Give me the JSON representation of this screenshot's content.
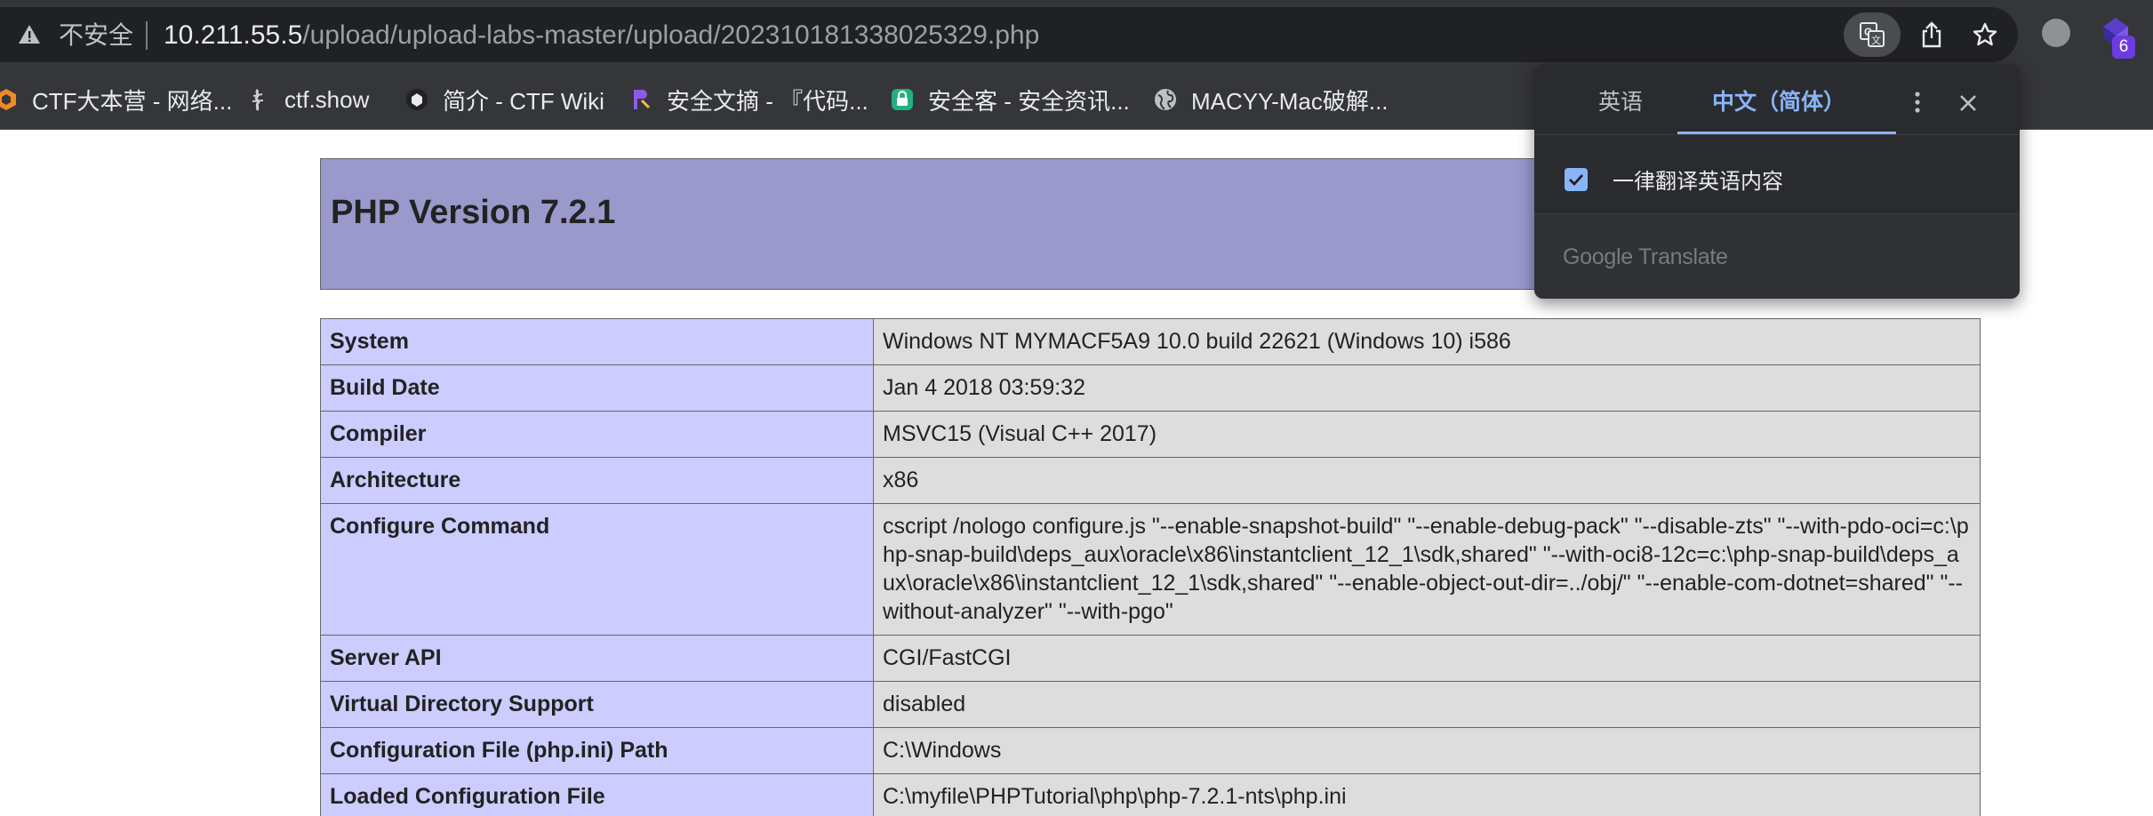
{
  "browser": {
    "insecure_label": "不安全",
    "url_host": "10.211.55.5",
    "url_path": "/upload/upload-labs-master/upload/202310181338025329.php",
    "extension_badge": "6"
  },
  "bookmarks": [
    {
      "label": "CTF大本营 - 网络...",
      "icon": "ctf-camp-icon"
    },
    {
      "label": "ctf.show",
      "icon": "ctfshow-icon"
    },
    {
      "label": "简介 - CTF Wiki",
      "icon": "ctf-wiki-icon"
    },
    {
      "label": "安全文摘 - 『代码...",
      "icon": "security-digest-icon"
    },
    {
      "label": "安全客 - 安全资讯...",
      "icon": "anquanke-icon"
    },
    {
      "label": "MACYY-Mac破解...",
      "icon": "globe-icon"
    }
  ],
  "php": {
    "title": "PHP Version 7.2.1",
    "rows": [
      {
        "label": "System",
        "value": "Windows NT MYMACF5A9 10.0 build 22621 (Windows 10) i586"
      },
      {
        "label": "Build Date",
        "value": "Jan 4 2018 03:59:32"
      },
      {
        "label": "Compiler",
        "value": "MSVC15 (Visual C++ 2017)"
      },
      {
        "label": "Architecture",
        "value": "x86"
      },
      {
        "label": "Configure Command",
        "value": "cscript /nologo configure.js \"--enable-snapshot-build\" \"--enable-debug-pack\" \"--disable-zts\" \"--with-pdo-oci=c:\\php-snap-build\\deps_aux\\oracle\\x86\\instantclient_12_1\\sdk,shared\" \"--with-oci8-12c=c:\\php-snap-build\\deps_aux\\oracle\\x86\\instantclient_12_1\\sdk,shared\" \"--enable-object-out-dir=../obj/\" \"--enable-com-dotnet=shared\" \"--without-analyzer\" \"--with-pgo\""
      },
      {
        "label": "Server API",
        "value": "CGI/FastCGI"
      },
      {
        "label": "Virtual Directory Support",
        "value": "disabled"
      },
      {
        "label": "Configuration File (php.ini) Path",
        "value": "C:\\Windows"
      },
      {
        "label": "Loaded Configuration File",
        "value": "C:\\myfile\\PHPTutorial\\php\\php-7.2.1-nts\\php.ini"
      }
    ]
  },
  "translate_popup": {
    "source_tab": "英语",
    "target_tab": "中文（简体）",
    "always_translate_label": "一律翻译英语内容",
    "always_translate_checked": true,
    "footer_logo": "Google Translate"
  },
  "colors": {
    "php_header": "#9999cc",
    "php_label_cell": "#ccccff",
    "php_value_cell": "#dddddd",
    "chrome_dark": "#35363a",
    "accent_blue": "#8ab4f8"
  }
}
